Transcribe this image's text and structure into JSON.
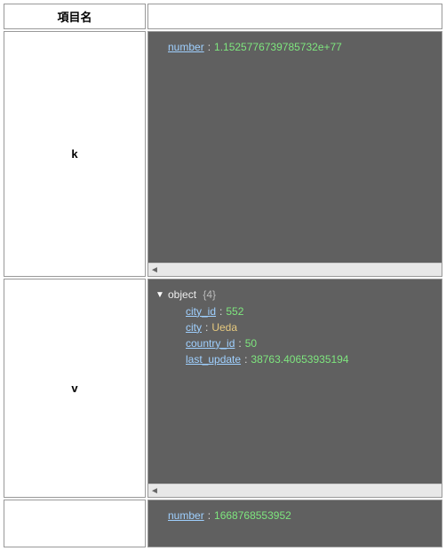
{
  "header": {
    "col1": "項目名",
    "col2": ""
  },
  "rows": [
    {
      "key": "k",
      "viewer": {
        "lines": [
          {
            "indent": 0,
            "key": "number",
            "valType": "num",
            "val": "1.1525776739785732e+77"
          }
        ],
        "scroll": true,
        "heightClass": "h-k"
      }
    },
    {
      "key": "v",
      "viewer": {
        "lines": [
          {
            "indent": 0,
            "toggle": "▼",
            "type": "object",
            "count": "{4}"
          },
          {
            "indent": 1,
            "key": "city_id",
            "valType": "num",
            "val": "552"
          },
          {
            "indent": 1,
            "key": "city",
            "valType": "str",
            "val": "Ueda"
          },
          {
            "indent": 1,
            "key": "country_id",
            "valType": "num",
            "val": "50"
          },
          {
            "indent": 1,
            "key": "last_update",
            "valType": "num",
            "val": "38763.40653935194"
          }
        ],
        "scroll": true,
        "heightClass": "h-v"
      }
    },
    {
      "key": "",
      "viewer": {
        "lines": [
          {
            "indent": 0,
            "key": "number",
            "valType": "num",
            "val": "1668768553952"
          }
        ],
        "scroll": false,
        "heightClass": "h-n"
      }
    }
  ]
}
